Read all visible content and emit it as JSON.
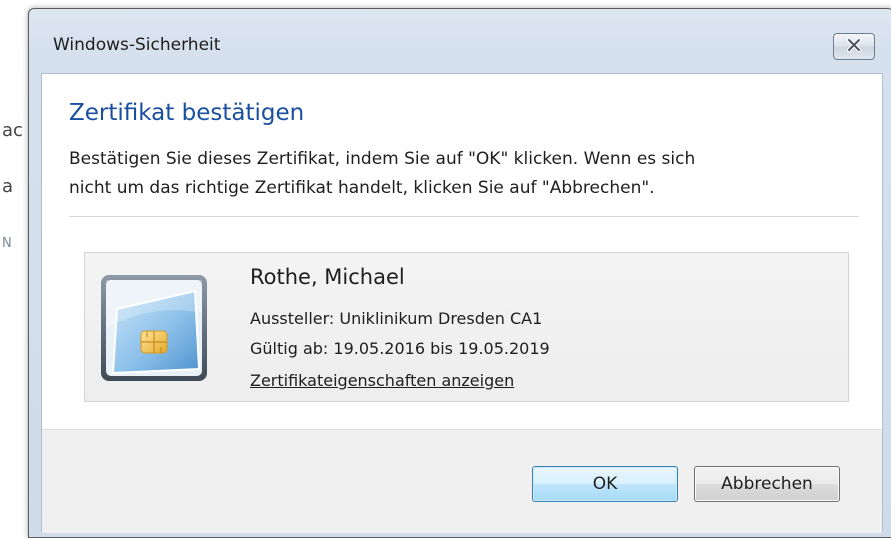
{
  "background": {
    "fragments": [
      "ac",
      "a",
      "N"
    ]
  },
  "window": {
    "title": "Windows-Sicherheit",
    "close_icon": "close-icon"
  },
  "content": {
    "heading": "Zertifikat bestätigen",
    "description_line1": "Bestätigen Sie dieses Zertifikat, indem Sie auf \"OK\" klicken. Wenn es sich",
    "description_line2": "nicht um das richtige Zertifikat handelt, klicken Sie auf \"Abbrechen\"."
  },
  "certificate": {
    "icon": "smartcard-icon",
    "name": "Rothe, Michael",
    "issuer": "Aussteller: Uniklinikum Dresden CA1",
    "validity": "Gültig ab: 19.05.2016 bis 19.05.2019",
    "properties_link": "Zertifikateigenschaften anzeigen"
  },
  "buttons": {
    "ok_label": "OK",
    "cancel_label": "Abbrechen"
  },
  "colors": {
    "heading": "#1a4fa0",
    "ok_border": "#3c7fb1"
  }
}
